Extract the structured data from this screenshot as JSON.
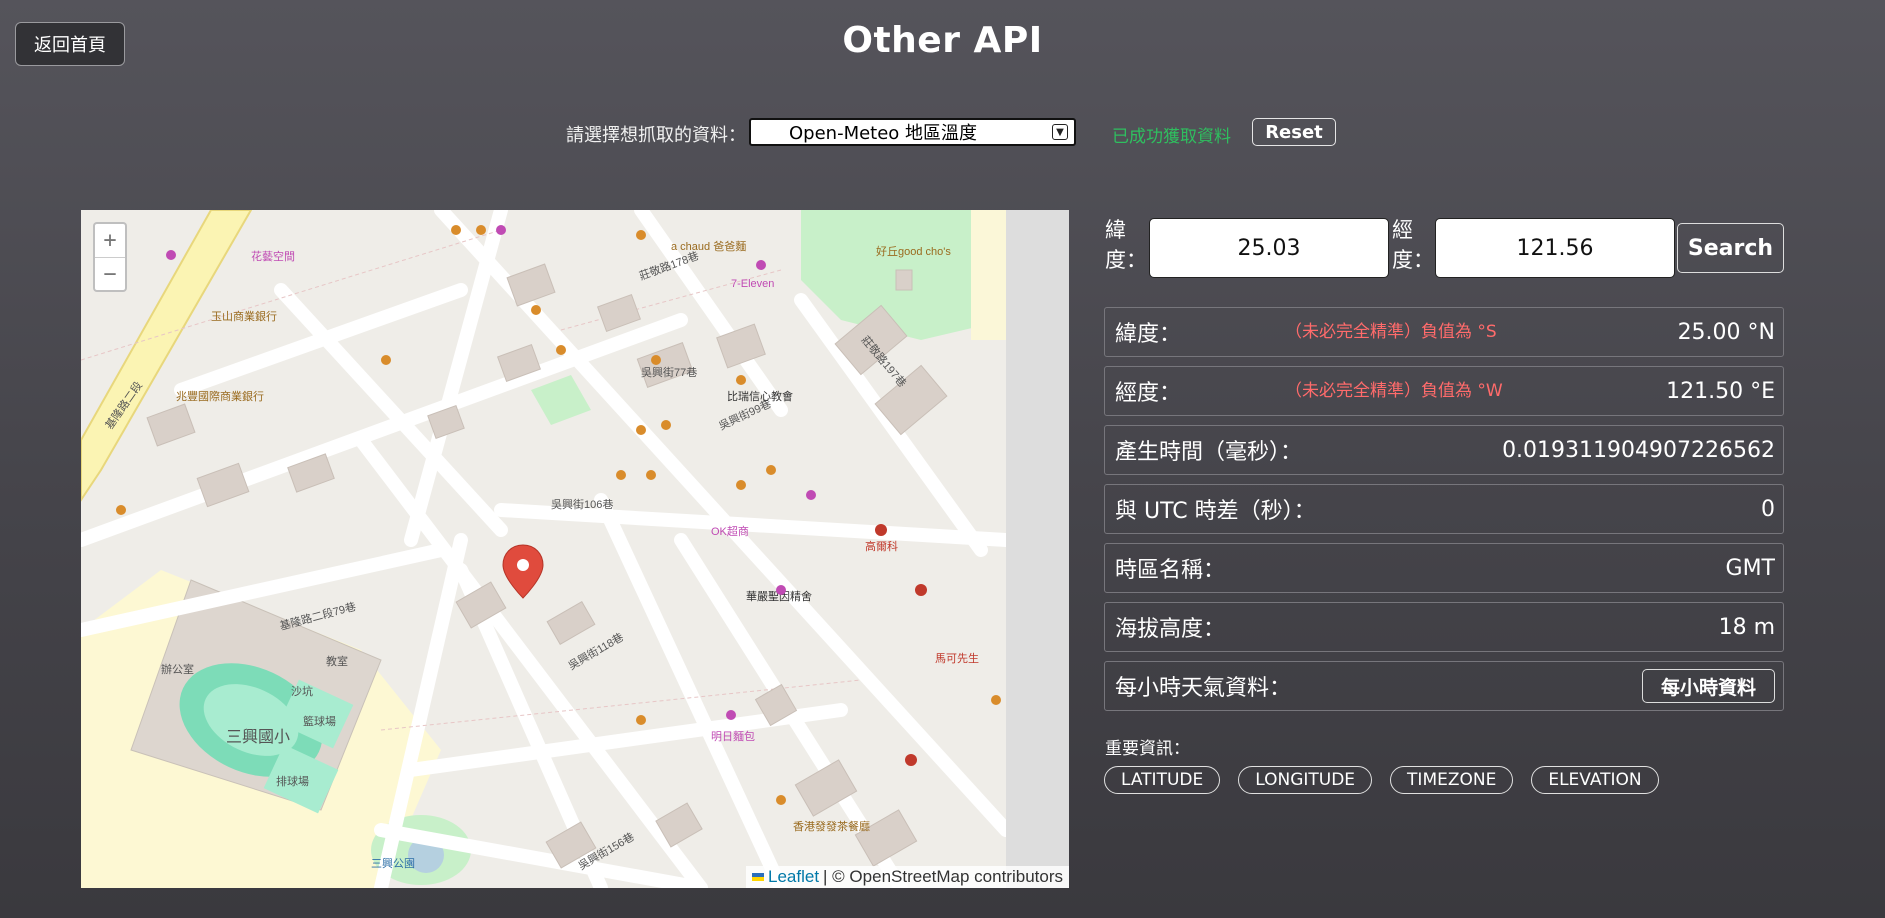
{
  "header": {
    "home_label": "返回首頁",
    "title": "Other API"
  },
  "controls": {
    "select_label": "請選擇想抓取的資料：",
    "selected_option": "Open-Meteo 地區溫度",
    "status": "已成功獲取資料",
    "reset_label": "Reset"
  },
  "map": {
    "zoom_in": "+",
    "zoom_out": "−",
    "attribution_link": "Leaflet",
    "attribution_text": "| © OpenStreetMap contributors",
    "labels": {
      "school": "三興國小",
      "church": "比瑞信心教會",
      "temple": "華嚴聖因精舍",
      "park": "三興公園",
      "street_1": "吳興街106巷",
      "street_2": "吳興街118巷",
      "street_3": "吳興街156巷",
      "street_4": "基隆路二段79巷",
      "street_5": "基隆路二段",
      "street_6": "莊敬路178巷",
      "street_7": "莊敬路197巷",
      "street_8": "吳興街77巷",
      "street_9": "吳興街99巷",
      "poi_1": "好丘good cho's",
      "poi_2": "7-Eleven",
      "poi_3": "OK超商",
      "poi_4": "明日麵包",
      "poi_5": "香港發發茶餐廳",
      "poi_6": "高爾科",
      "poi_7": "馬可先生",
      "poi_8": "花藝空間",
      "poi_9": "玉山商業銀行",
      "poi_10": "兆豐國際商業銀行",
      "poi_11": "a chaud 爸爸麵",
      "poi_12": "教室",
      "poi_13": "辦公室",
      "poi_14": "籃球場",
      "poi_15": "排球場",
      "poi_16": "沙坑"
    }
  },
  "coords": {
    "lat_label": "緯度：",
    "lat_value": "25.03",
    "lon_label": "經度：",
    "lon_value": "121.56",
    "search_label": "Search"
  },
  "info": {
    "latitude": {
      "label": "緯度：",
      "note": "（未必完全精準）負值為 °S",
      "value": "25.00 °N"
    },
    "longitude": {
      "label": "經度：",
      "note": "（未必完全精準）負值為 °W",
      "value": "121.50 °E"
    },
    "generation_time": {
      "label": "產生時間（毫秒）：",
      "value": "0.019311904907226562"
    },
    "utc_offset": {
      "label": "與 UTC 時差（秒）：",
      "value": "0"
    },
    "timezone": {
      "label": "時區名稱：",
      "value": "GMT"
    },
    "elevation": {
      "label": "海拔高度：",
      "value": "18 m"
    },
    "hourly": {
      "label": "每小時天氣資料：",
      "button": "每小時資料"
    }
  },
  "important": {
    "title": "重要資訊：",
    "tags": [
      "LATITUDE",
      "LONGITUDE",
      "TIMEZONE",
      "ELEVATION"
    ]
  },
  "colors": {
    "background": "#4d4c52",
    "status_ok": "#2fbf5f",
    "note_red": "#ff6b6b",
    "marker_red": "#e04b3d"
  }
}
